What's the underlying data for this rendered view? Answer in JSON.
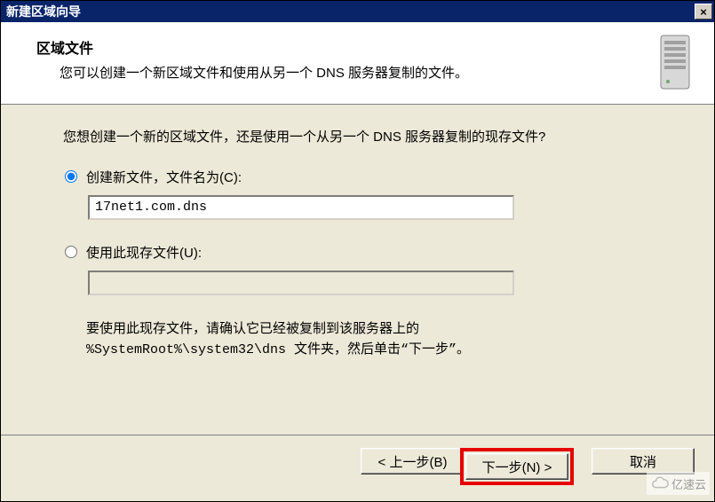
{
  "titlebar": {
    "title": "新建区域向导",
    "close_label": "×"
  },
  "header": {
    "title": "区域文件",
    "description": "您可以创建一个新区域文件和使用从另一个 DNS 服务器复制的文件。"
  },
  "content": {
    "question": "您想创建一个新的区域文件，还是使用一个从另一个 DNS 服务器复制的现存文件?",
    "radio_create_label": "创建新文件，文件名为(C):",
    "create_value": "17net1.com.dns",
    "radio_existing_label": "使用此现存文件(U):",
    "existing_value": "",
    "note_line1": "要使用此现存文件，请确认它已经被复制到该服务器上的",
    "note_line2": "%SystemRoot%\\system32\\dns 文件夹，然后单击“下一步”。"
  },
  "footer": {
    "back_label": "< 上一步(B)",
    "next_label": "下一步(N) >",
    "cancel_label": "取消"
  },
  "watermark": {
    "text": "亿速云"
  }
}
